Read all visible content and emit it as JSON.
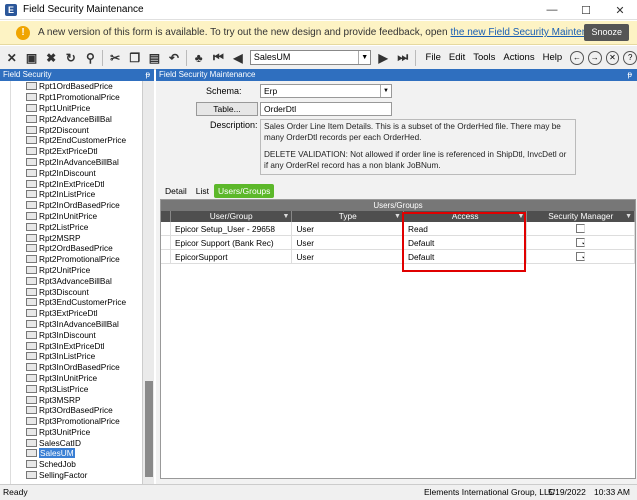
{
  "window": {
    "title": "Field Security Maintenance",
    "app_icon": "E",
    "controls": [
      "—",
      "☐",
      "✕"
    ]
  },
  "banner": {
    "text": "A new version of this form is available. To try out the new design and provide feedback, open",
    "link": "the new Field Security Maintenance",
    "snooze": "Snooze"
  },
  "toolbar": {
    "combo_value": "SalesUM",
    "menu": [
      "File",
      "Edit",
      "Tools",
      "Actions",
      "Help"
    ]
  },
  "left_panel": {
    "header": "Field Security",
    "pin": "ᵽ",
    "items": [
      "Rpt1OrdBasedPrice",
      "Rpt1PromotionalPrice",
      "Rpt1UnitPrice",
      "Rpt2AdvanceBillBal",
      "Rpt2Discount",
      "Rpt2EndCustomerPrice",
      "Rpt2ExtPriceDtl",
      "Rpt2InAdvanceBillBal",
      "Rpt2InDiscount",
      "Rpt2InExtPriceDtl",
      "Rpt2InListPrice",
      "Rpt2InOrdBasedPrice",
      "Rpt2InUnitPrice",
      "Rpt2ListPrice",
      "Rpt2MSRP",
      "Rpt2OrdBasedPrice",
      "Rpt2PromotionalPrice",
      "Rpt2UnitPrice",
      "Rpt3AdvanceBillBal",
      "Rpt3Discount",
      "Rpt3EndCustomerPrice",
      "Rpt3ExtPriceDtl",
      "Rpt3InAdvanceBillBal",
      "Rpt3InDiscount",
      "Rpt3InExtPriceDtl",
      "Rpt3InListPrice",
      "Rpt3InOrdBasedPrice",
      "Rpt3InUnitPrice",
      "Rpt3ListPrice",
      "Rpt3MSRP",
      "Rpt3OrdBasedPrice",
      "Rpt3PromotionalPrice",
      "Rpt3UnitPrice",
      "SalesCatID",
      "SalesUM",
      "SchedJob",
      "SellingFactor"
    ],
    "selected": "SalesUM"
  },
  "form": {
    "header": "Field Security Maintenance",
    "pin": "ᵽ",
    "schema_label": "Schema:",
    "schema_value": "Erp",
    "table_button": "Table...",
    "table_value": "OrderDtl",
    "description_label": "Description:",
    "description_line1": "Sales Order Line Item Details. This is a subset of the OrderHed file. There may be many OrderDtl records per each OrderHed.",
    "description_line2": "DELETE VALIDATION: Not allowed if order line is referenced in  ShipDtl,  InvcDetl or if any OrderRel record has a non blank JoBNum.",
    "tabs": [
      "Detail",
      "List",
      "Users/Groups"
    ],
    "active_tab": "Users/Groups"
  },
  "grid": {
    "group_title": "Users/Groups",
    "columns": [
      "User/Group",
      "Type",
      "Access",
      "Security Manager"
    ],
    "rows": [
      {
        "user_group": "Epicor Setup_User - 29658",
        "type": "User",
        "access": "Read",
        "security_manager": false
      },
      {
        "user_group": "Epicor Support (Bank Rec)",
        "type": "User",
        "access": "Default",
        "security_manager": true
      },
      {
        "user_group": "EpicorSupport",
        "type": "User",
        "access": "Default",
        "security_manager": true
      }
    ]
  },
  "status": {
    "ready": "Ready",
    "company": "Elements International Group, LLC",
    "date": "5/19/2022",
    "time": "10:33 AM"
  }
}
